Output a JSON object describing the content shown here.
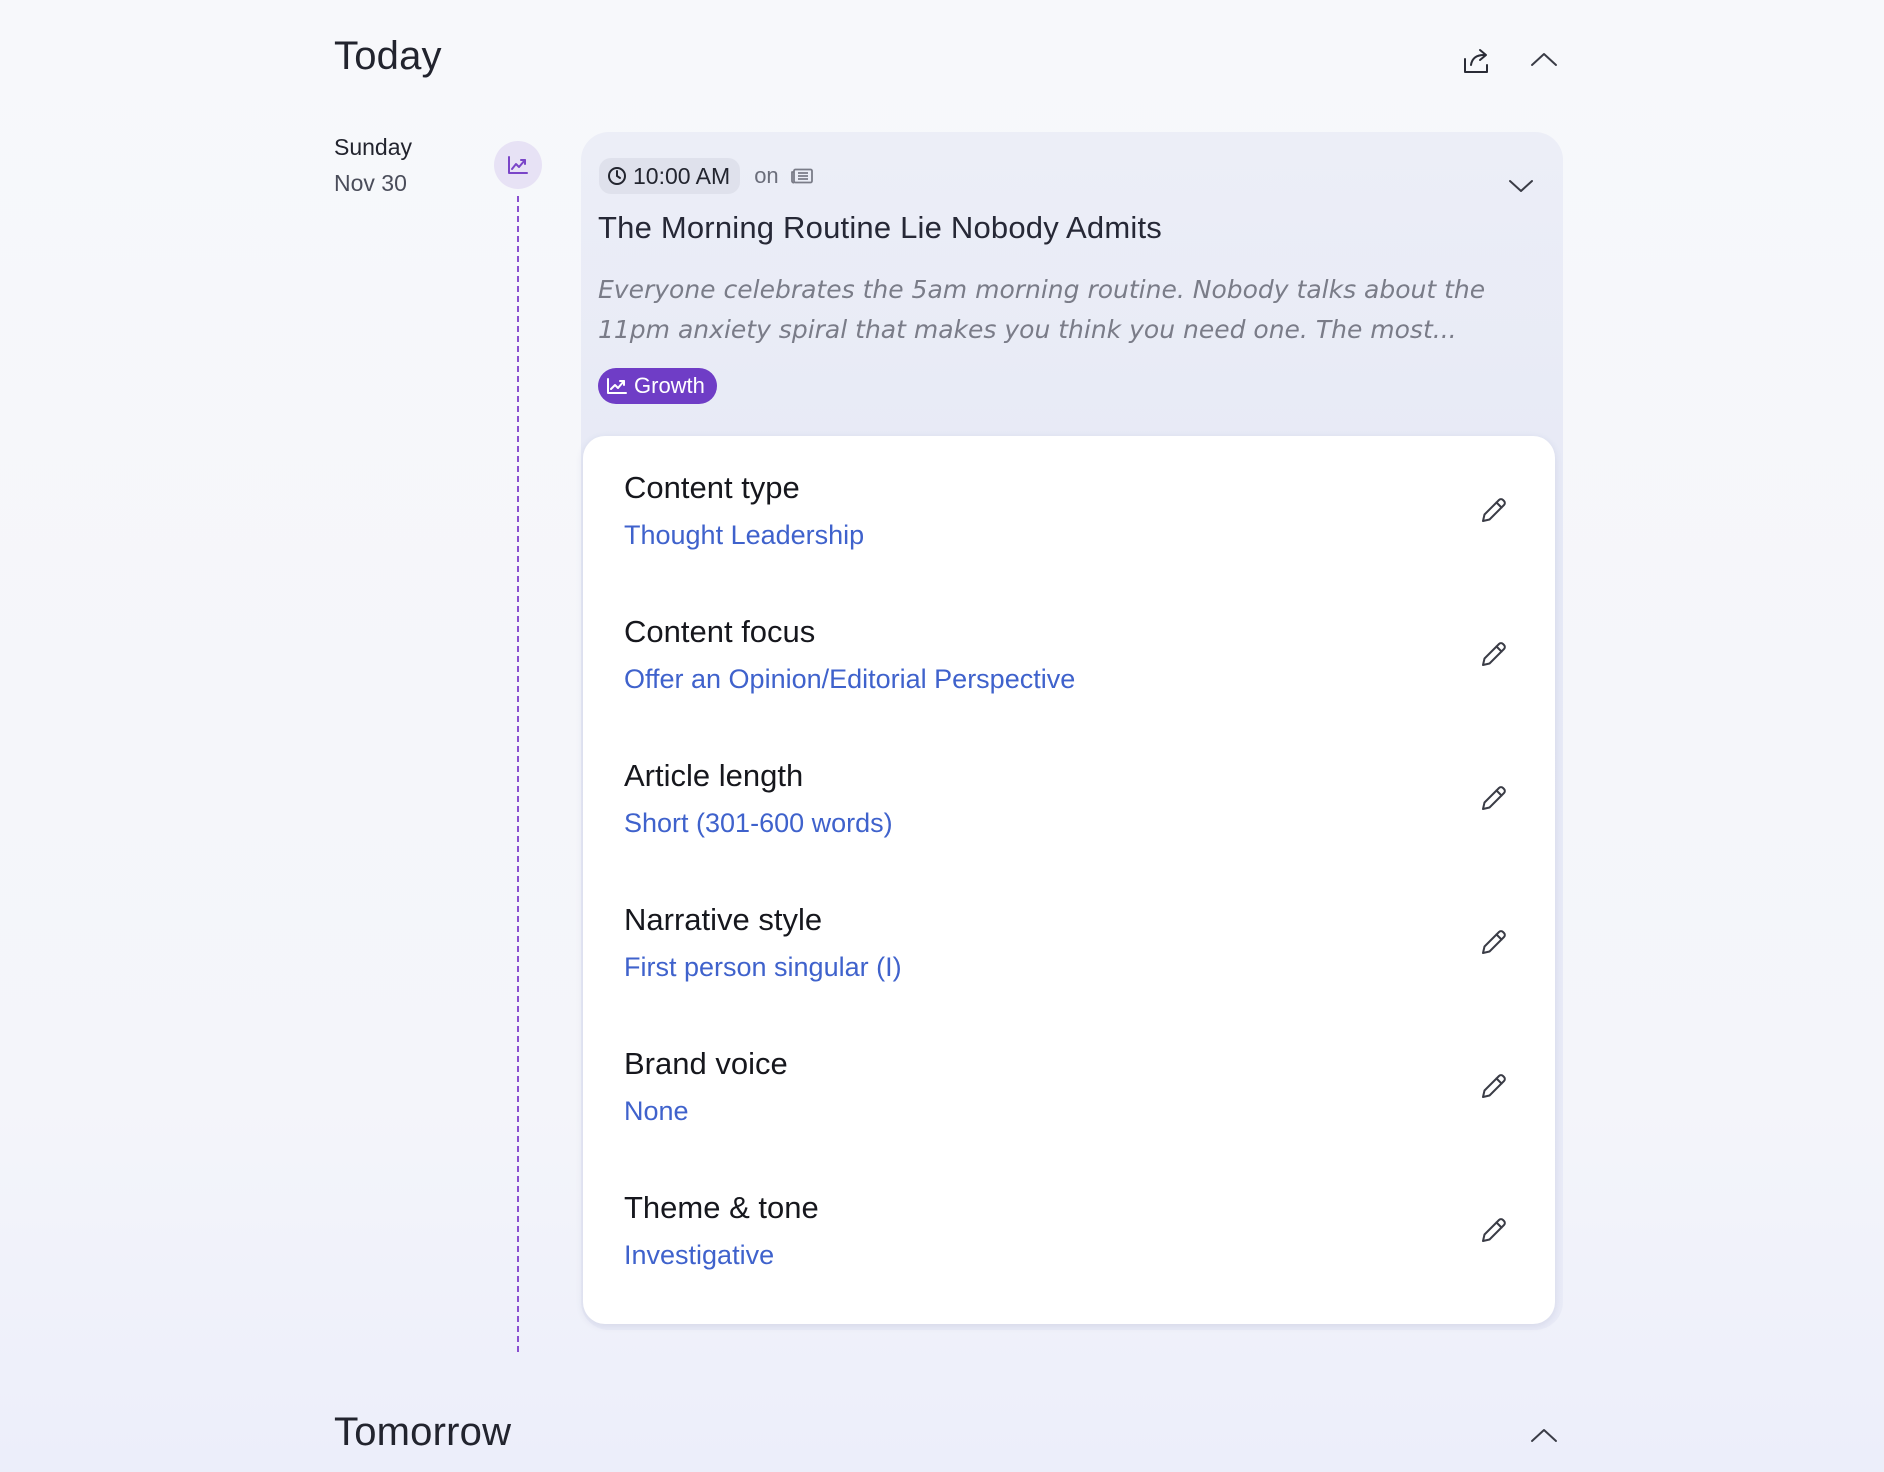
{
  "today": {
    "title": "Today",
    "share_icon": "share-icon",
    "collapse_icon": "chevron-up-icon"
  },
  "entry": {
    "day": "Sunday",
    "date": "Nov 30",
    "timeline_icon": "growth-chart-icon"
  },
  "post": {
    "time": "10:00 AM",
    "on_text": "on",
    "source_icon": "newspaper-icon",
    "title": "The Morning Routine Lie Nobody Admits",
    "excerpt": "Everyone celebrates the 5am morning routine. Nobody talks about the 11pm anxiety spiral that makes you think you need one. The most...",
    "tag": "Growth",
    "tag_color": "#6f3dc6"
  },
  "settings": [
    {
      "label": "Content type",
      "value": "Thought Leadership"
    },
    {
      "label": "Content focus",
      "value": "Offer an Opinion/Editorial Perspective"
    },
    {
      "label": "Article length",
      "value": "Short (301-600 words)"
    },
    {
      "label": "Narrative style",
      "value": "First person singular (I)"
    },
    {
      "label": "Brand voice",
      "value": "None"
    },
    {
      "label": "Theme & tone",
      "value": "Investigative"
    }
  ],
  "tomorrow": {
    "title": "Tomorrow",
    "collapse_icon": "chevron-up-icon"
  },
  "colors": {
    "accent": "#6f3dc6",
    "link": "#3f62cc",
    "timeline": "#8a4fd0"
  }
}
